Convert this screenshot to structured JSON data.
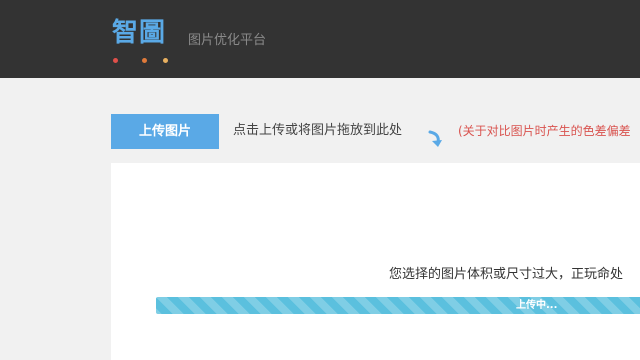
{
  "header": {
    "logo_text": "智圖",
    "tagline": "图片优化平台",
    "dots": [
      "#e0504a",
      "#e07a3a",
      "#e8b060"
    ]
  },
  "upload": {
    "button_label": "上传图片",
    "hint": "点击上传或将图片拖放到此处",
    "note": "(关于对比图片时产生的色差偏差"
  },
  "panel": {
    "status_message": "您选择的图片体积或尺寸过大，正玩命处",
    "progress_label": "上传中..."
  },
  "colors": {
    "accent": "#5aa9e6",
    "progress": "#5bc0de",
    "note": "#d9534f"
  },
  "icons": {
    "hint_arrow": "curved-arrow-icon"
  }
}
